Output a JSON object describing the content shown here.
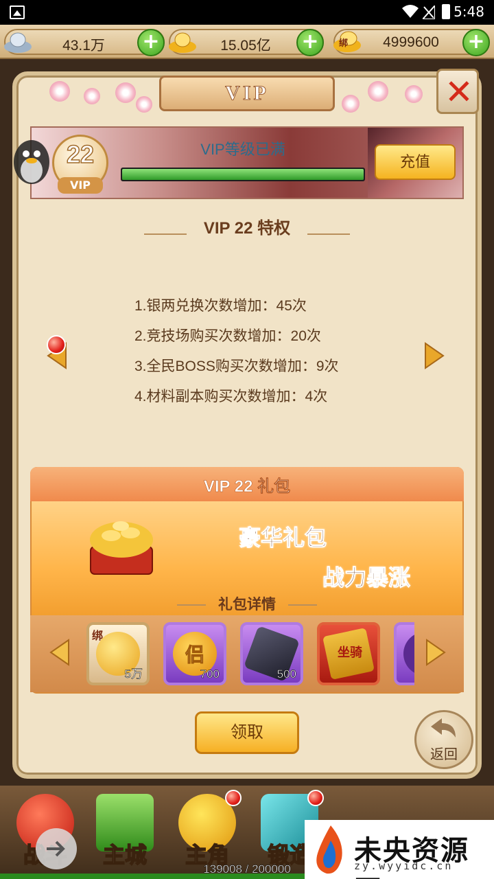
{
  "status_bar": {
    "time": "5:48"
  },
  "currency": {
    "silver": "43.1万",
    "gold": "15.05亿",
    "bound_gold": "4999600",
    "bound_gold_badge": "绑"
  },
  "panel": {
    "title": "VIP"
  },
  "banner": {
    "vip_level": "22",
    "vip_badge_label": "VIP",
    "status_text": "VIP等级已满",
    "progress_fraction": 1.0,
    "recharge_label": "充值"
  },
  "privileges": {
    "title": "VIP 22 特权",
    "items": [
      "1.银两兑换次数增加：45次",
      "2.竞技场购买次数增加：20次",
      "3.全民BOSS购买次数增加：9次",
      "4.材料副本购买次数增加：4次"
    ]
  },
  "gift": {
    "title": "VIP 22 礼包",
    "slogan_line1": "豪华礼包",
    "slogan_line2": "战力暴涨",
    "detail_label": "礼包详情",
    "items": [
      {
        "name": "bound-gold-ingot",
        "badge": "绑",
        "count": "5万"
      },
      {
        "name": "lv-token",
        "badge": "侣",
        "count": "700"
      },
      {
        "name": "dark-ore",
        "count": "500"
      },
      {
        "name": "red-scroll",
        "badge": "坐骑",
        "count": ""
      },
      {
        "name": "purple-item",
        "count": ""
      }
    ],
    "claim_label": "领取"
  },
  "back_label": "返回",
  "bottom_nav": [
    {
      "label": "战斗",
      "badge": false
    },
    {
      "label": "主城",
      "badge": false
    },
    {
      "label": "主角",
      "badge": true
    },
    {
      "label": "锻造",
      "badge": true
    },
    {
      "label": "",
      "badge": false
    },
    {
      "label": "",
      "badge": true
    }
  ],
  "experience": "139008 / 200000",
  "watermark": {
    "name": "未央资源网",
    "url": "zy.wyyidc.cn"
  }
}
